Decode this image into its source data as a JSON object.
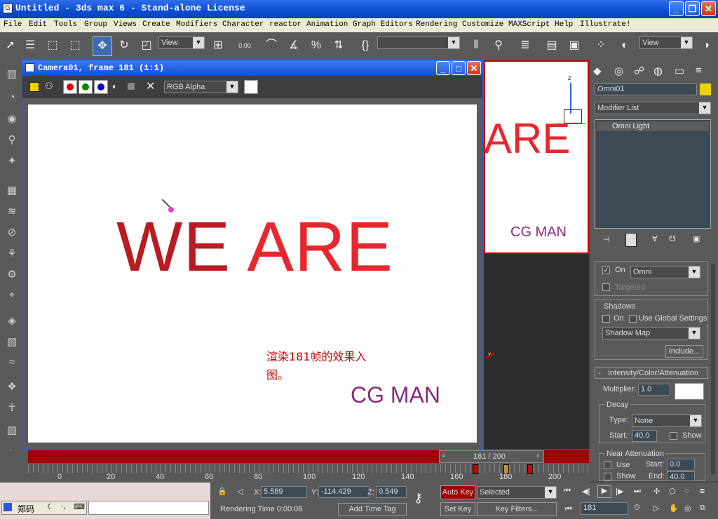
{
  "app": {
    "title": "Untitled - 3ds max 6 - Stand-alone License"
  },
  "menu": [
    "File",
    "Edit",
    "Tools",
    "Group",
    "Views",
    "Create",
    "Modifiers",
    "Character",
    "reactor",
    "Animation",
    "Graph Editors",
    "Rendering",
    "Customize",
    "MAXScript",
    "Help",
    "Illustrate!"
  ],
  "toolbar": {
    "view_combo": "View",
    "view_combo_2": "View",
    "spinner_value": "0.00"
  },
  "render_window": {
    "title": "Camera01, frame 181 (1:1)",
    "channel": "RGB Alpha",
    "image": {
      "headline": "WE ARE",
      "we_color": "#b81c22",
      "are_color": "#e8262e",
      "caption_line1": "渲染181帧的效果入",
      "caption_line2": "图。",
      "caption_color": "#c00000",
      "brand": "CG MAN",
      "brand_color": "#8a2a7a"
    }
  },
  "viewport": {
    "text": "ARE",
    "brand": "CG MAN",
    "axis_z": "z"
  },
  "command_panel": {
    "object_name": "Omni01",
    "object_color": "#f0d000",
    "modifier_list": "Modifier List",
    "stack_item": "Omni Light",
    "on_label": "On",
    "light_type": "Omni",
    "targeted_label": "Targeted",
    "shadows_label": "Shadows",
    "shadows_on": "On",
    "use_global": "Use Global Settings",
    "shadow_type": "Shadow Map",
    "include_button": "Include...",
    "rollout_title": "Intensity/Color/Attenuation",
    "multiplier_label": "Multiplier:",
    "multiplier_value": "1.0",
    "decay_label": "Decay",
    "type_label": "Type:",
    "type_value": "None",
    "start_label": "Start:",
    "start_value": "40.0",
    "show_label": "Show",
    "near_label": "Near Attenuation",
    "use_label": "Use",
    "near_start_label": "Start:",
    "near_start_value": "0.0",
    "near_show_label": "Show",
    "end_label": "End:",
    "end_value": "40.0"
  },
  "timeline": {
    "frame_display": "181 / 200",
    "current_frame": 181,
    "total_frames": 200,
    "ticks": [
      "0",
      "20",
      "40",
      "60",
      "80",
      "100",
      "120",
      "140",
      "160",
      "180",
      "200"
    ]
  },
  "status": {
    "x_label": "X:",
    "x_value": "5.589",
    "y_label": "Y:",
    "y_value": "-114.429",
    "z_label": "Z:",
    "z_value": "0.549",
    "auto_key": "Auto Key",
    "set_key": "Set Key",
    "selected": "Selected",
    "key_filters": "Key Filters...",
    "frame_field": "181",
    "rendering_time": "Rendering Time  0:00:08",
    "add_time_tag": "Add Time Tag",
    "ime": "郑码"
  }
}
